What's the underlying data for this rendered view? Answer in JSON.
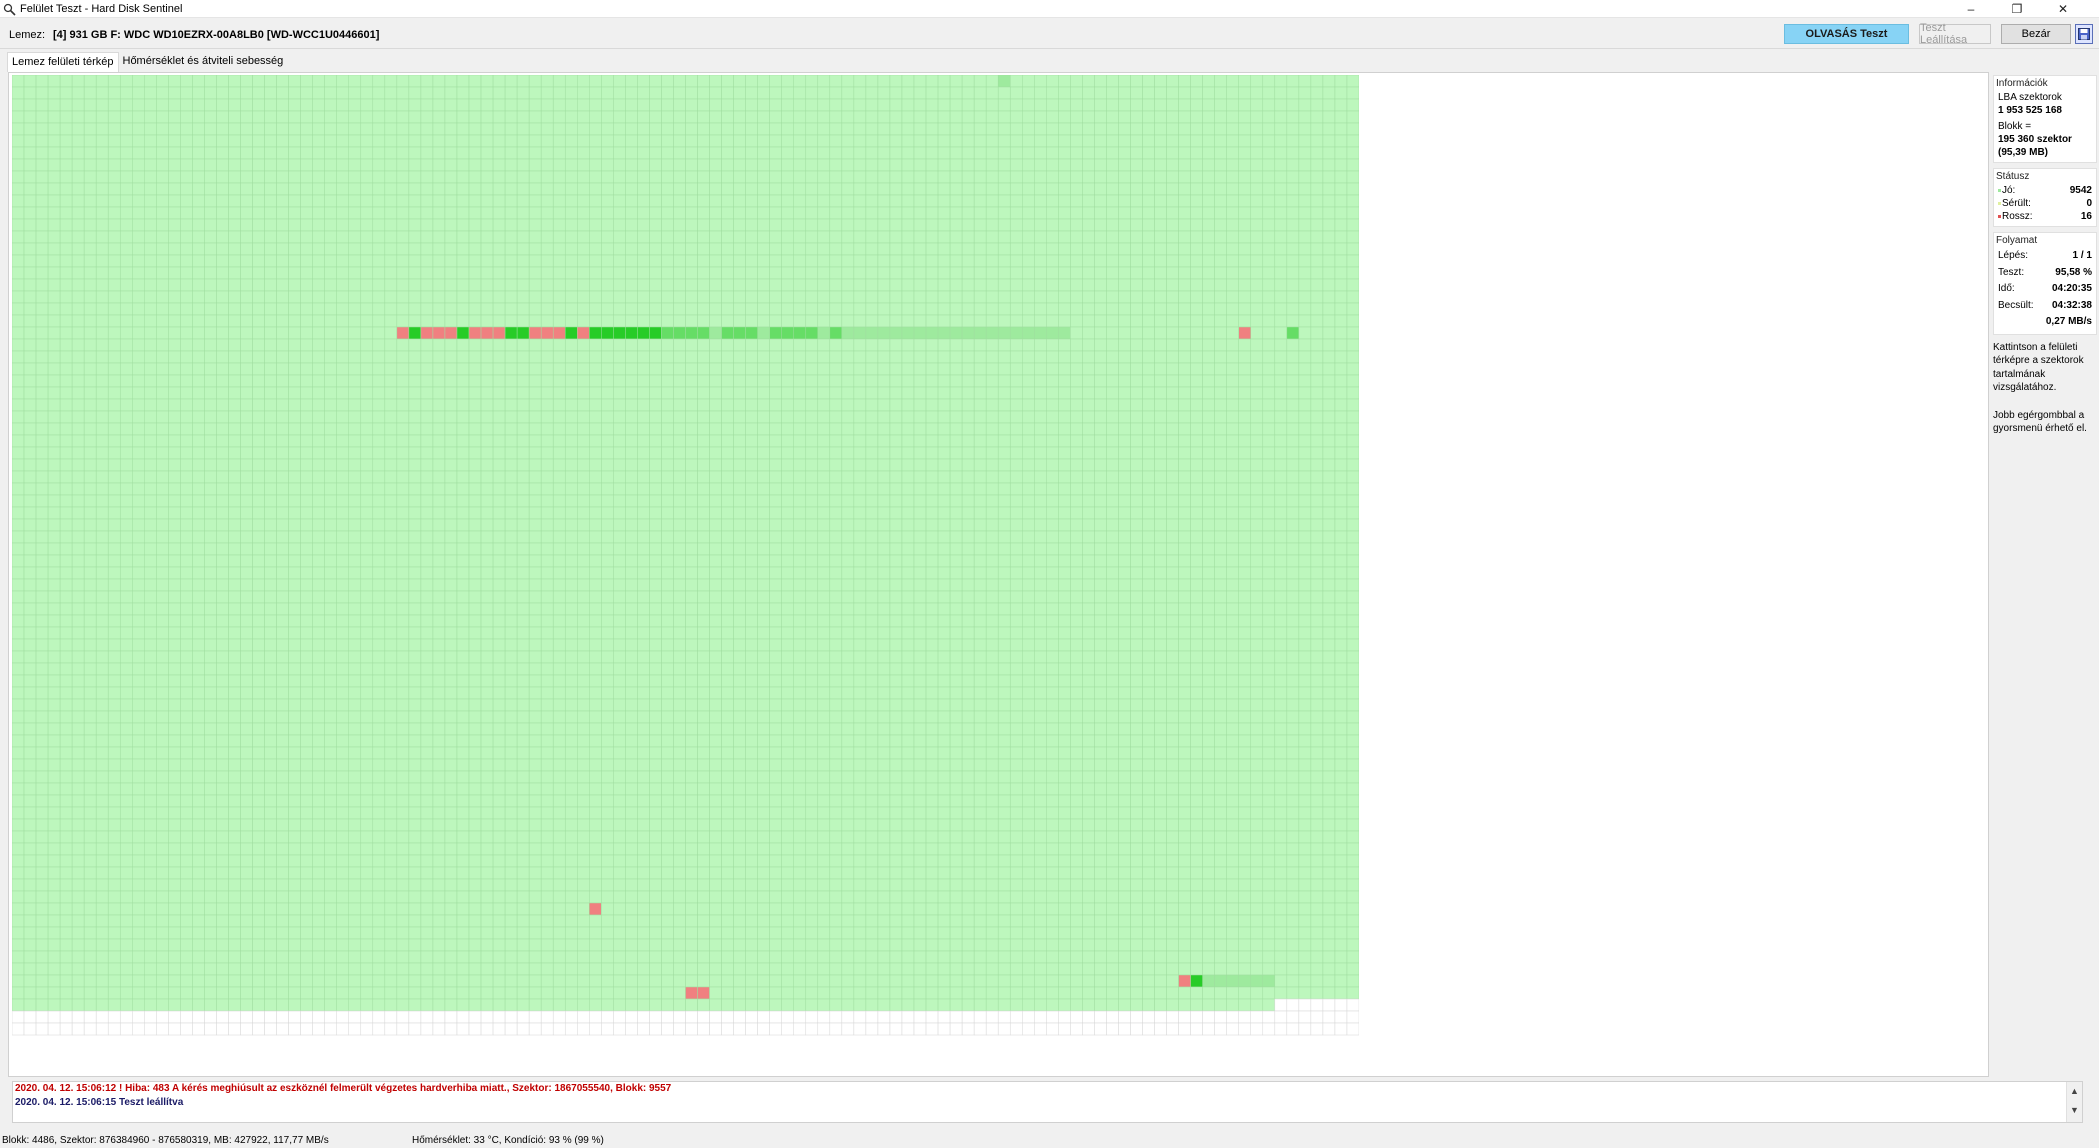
{
  "window": {
    "title": "Felület Teszt - Hard Disk Sentinel",
    "controls": {
      "minimize": "–",
      "restore": "❐",
      "close": "✕"
    }
  },
  "toolbar": {
    "disk_label": "Lemez:",
    "disk_name": "[4] 931 GB F: WDC WD10EZRX-00A8LB0 [WD-WCC1U0446601]",
    "read_test_button": "OLVASÁS Teszt",
    "stop_test_button": "Teszt Leállítása",
    "close_button": "Bezár",
    "save_icon": "floppy-disk-icon"
  },
  "tabs": [
    {
      "label": "Lemez felületi térkép",
      "active": true
    },
    {
      "label": "Hőmérséklet és átviteli sebesség",
      "active": false
    }
  ],
  "info": {
    "title": "Információk",
    "lba_label": "LBA szektorok",
    "lba_value": "1 953 525 168",
    "block_label": "Blokk =",
    "block_value": "195 360 szektor",
    "block_mb": "(95,39 MB)"
  },
  "status": {
    "title": "Státusz",
    "good_label": "Jó:",
    "good_value": "9542",
    "damaged_label": "Sérült:",
    "damaged_value": "0",
    "bad_label": "Rossz:",
    "bad_value": "16"
  },
  "progress": {
    "title": "Folyamat",
    "step_label": "Lépés:",
    "step_value": "1 / 1",
    "test_label": "Teszt:",
    "test_value": "95,58 %",
    "time_label": "Idő:",
    "time_value": "04:20:35",
    "estimated_label": "Becsült:",
    "estimated_value": "04:32:38",
    "speed_value": "0,27 MB/s"
  },
  "notes": {
    "click_hint": "Kattintson a felületi térképre a szektorok tartalmának vizsgálatához.",
    "right_click_hint": "Jobb egérgombbal a gyorsmenü érhető el."
  },
  "log": [
    {
      "type": "error",
      "text": "2020. 04. 12.  15:06:12 ! Hiba: 483 A kérés meghiúsult az eszköznél felmerült végzetes hardverhiba miatt., Szektor: 1867055540, Blokk: 9557"
    },
    {
      "type": "info",
      "text": "2020. 04. 12.  15:06:15   Teszt leállítva"
    }
  ],
  "statusbar": {
    "block_info": "Blokk: 4486, Szektor: 876384960 - 876580319, MB: 427922, 117,77 MB/s",
    "temp_info": "Hőmérséklet: 33  °C,  Kondíció: 93 % (99 %)"
  },
  "surface_map": {
    "columns": 112,
    "rows": 80,
    "tested_full_rows": 77,
    "tested_cells_in_last_row": 105,
    "colors": {
      "good": "#bdf7bd",
      "grid": "#9fdd9f",
      "untested": "#ffffff",
      "untested_grid": "#d6d6d6",
      "bad": "#f08080",
      "fast": "#27cc27",
      "medium": "#66dd66",
      "slow": "#9eea9e"
    },
    "special_cells": [
      {
        "row": 0,
        "col": 82,
        "state": "slow"
      },
      {
        "row": 21,
        "col": 32,
        "state": "bad"
      },
      {
        "row": 21,
        "col": 33,
        "state": "fast"
      },
      {
        "row": 21,
        "col": 34,
        "state": "bad"
      },
      {
        "row": 21,
        "col": 35,
        "state": "bad"
      },
      {
        "row": 21,
        "col": 36,
        "state": "bad"
      },
      {
        "row": 21,
        "col": 37,
        "state": "fast"
      },
      {
        "row": 21,
        "col": 38,
        "state": "bad"
      },
      {
        "row": 21,
        "col": 39,
        "state": "bad"
      },
      {
        "row": 21,
        "col": 40,
        "state": "bad"
      },
      {
        "row": 21,
        "col": 41,
        "state": "fast"
      },
      {
        "row": 21,
        "col": 42,
        "state": "fast"
      },
      {
        "row": 21,
        "col": 43,
        "state": "bad"
      },
      {
        "row": 21,
        "col": 44,
        "state": "bad"
      },
      {
        "row": 21,
        "col": 45,
        "state": "bad"
      },
      {
        "row": 21,
        "col": 46,
        "state": "fast"
      },
      {
        "row": 21,
        "col": 47,
        "state": "bad"
      },
      {
        "row": 21,
        "col": 48,
        "state": "fast"
      },
      {
        "row": 21,
        "col": 49,
        "state": "fast"
      },
      {
        "row": 21,
        "col": 50,
        "state": "fast"
      },
      {
        "row": 21,
        "col": 51,
        "state": "fast"
      },
      {
        "row": 21,
        "col": 52,
        "state": "fast"
      },
      {
        "row": 21,
        "col": 53,
        "state": "fast"
      },
      {
        "row": 21,
        "col": 54,
        "state": "medium"
      },
      {
        "row": 21,
        "col": 55,
        "state": "medium"
      },
      {
        "row": 21,
        "col": 56,
        "state": "medium"
      },
      {
        "row": 21,
        "col": 57,
        "state": "medium"
      },
      {
        "row": 21,
        "col": 58,
        "state": "slow"
      },
      {
        "row": 21,
        "col": 59,
        "state": "medium"
      },
      {
        "row": 21,
        "col": 60,
        "state": "medium"
      },
      {
        "row": 21,
        "col": 61,
        "state": "medium"
      },
      {
        "row": 21,
        "col": 62,
        "state": "slow"
      },
      {
        "row": 21,
        "col": 63,
        "state": "medium"
      },
      {
        "row": 21,
        "col": 64,
        "state": "medium"
      },
      {
        "row": 21,
        "col": 65,
        "state": "medium"
      },
      {
        "row": 21,
        "col": 66,
        "state": "medium"
      },
      {
        "row": 21,
        "col": 67,
        "state": "slow"
      },
      {
        "row": 21,
        "col": 68,
        "state": "medium"
      },
      {
        "row": 21,
        "col": 69,
        "state": "slow"
      },
      {
        "row": 21,
        "col": 70,
        "state": "slow"
      },
      {
        "row": 21,
        "col": 71,
        "state": "slow"
      },
      {
        "row": 21,
        "col": 72,
        "state": "slow"
      },
      {
        "row": 21,
        "col": 73,
        "state": "slow"
      },
      {
        "row": 21,
        "col": 74,
        "state": "slow"
      },
      {
        "row": 21,
        "col": 75,
        "state": "slow"
      },
      {
        "row": 21,
        "col": 76,
        "state": "slow"
      },
      {
        "row": 21,
        "col": 77,
        "state": "slow"
      },
      {
        "row": 21,
        "col": 78,
        "state": "slow"
      },
      {
        "row": 21,
        "col": 79,
        "state": "slow"
      },
      {
        "row": 21,
        "col": 80,
        "state": "slow"
      },
      {
        "row": 21,
        "col": 81,
        "state": "slow"
      },
      {
        "row": 21,
        "col": 82,
        "state": "slow"
      },
      {
        "row": 21,
        "col": 83,
        "state": "slow"
      },
      {
        "row": 21,
        "col": 84,
        "state": "slow"
      },
      {
        "row": 21,
        "col": 85,
        "state": "slow"
      },
      {
        "row": 21,
        "col": 86,
        "state": "slow"
      },
      {
        "row": 21,
        "col": 87,
        "state": "slow"
      },
      {
        "row": 21,
        "col": 102,
        "state": "bad"
      },
      {
        "row": 21,
        "col": 106,
        "state": "medium"
      },
      {
        "row": 69,
        "col": 48,
        "state": "bad"
      },
      {
        "row": 75,
        "col": 97,
        "state": "bad"
      },
      {
        "row": 75,
        "col": 98,
        "state": "fast"
      },
      {
        "row": 75,
        "col": 99,
        "state": "slow"
      },
      {
        "row": 75,
        "col": 100,
        "state": "slow"
      },
      {
        "row": 75,
        "col": 101,
        "state": "slow"
      },
      {
        "row": 75,
        "col": 102,
        "state": "slow"
      },
      {
        "row": 75,
        "col": 103,
        "state": "slow"
      },
      {
        "row": 75,
        "col": 104,
        "state": "slow"
      },
      {
        "row": 76,
        "col": 56,
        "state": "bad"
      },
      {
        "row": 76,
        "col": 57,
        "state": "bad"
      }
    ]
  }
}
